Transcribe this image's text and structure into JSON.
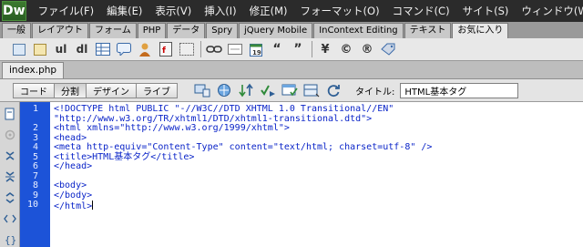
{
  "app": {
    "logo": "Dw"
  },
  "menu": [
    "ファイル(F)",
    "編集(E)",
    "表示(V)",
    "挿入(I)",
    "修正(M)",
    "フォーマット(O)",
    "コマンド(C)",
    "サイト(S)",
    "ウィンドウ(W)"
  ],
  "insert_tabs": [
    "一般",
    "レイアウト",
    "フォーム",
    "PHP",
    "データ",
    "Spry",
    "jQuery Mobile",
    "InContext Editing",
    "テキスト",
    "お気に入り"
  ],
  "insert_tab_active": "お気に入り",
  "insert_icons": [
    "image-icon",
    "image-icon-2",
    "ul",
    "dl",
    "table-icon",
    "comment-icon",
    "user-icon",
    "flash-icon",
    "div-icon",
    "link-icon",
    "spacer-icon",
    "date-icon",
    "“",
    "”",
    "¥",
    "©",
    "®",
    "tag-icon"
  ],
  "document": {
    "tab": "index.php"
  },
  "doc_toolbar": {
    "views": [
      "コード",
      "分割",
      "デザイン",
      "ライブ"
    ],
    "active_view": "分割",
    "title_label": "タイトル:",
    "title_value": "HTML基本タグ"
  },
  "editor": {
    "line_numbers": [
      "1",
      "2",
      "3",
      "4",
      "5",
      "6",
      "7",
      "8",
      "9",
      "10"
    ],
    "lines": [
      "<!DOCTYPE html PUBLIC \"-//W3C//DTD XHTML 1.0 Transitional//EN\"",
      "\"http://www.w3.org/TR/xhtml1/DTD/xhtml1-transitional.dtd\">",
      "<html xmlns=\"http://www.w3.org/1999/xhtml\">",
      "<head>",
      "<meta http-equiv=\"Content-Type\" content=\"text/html; charset=utf-8\" />",
      "<title>HTML基本タグ</title>",
      "</head>",
      "",
      "<body>",
      "</body>",
      "</html>"
    ]
  },
  "colors": {
    "gutter": "#1c53d8",
    "code_text": "#0a24c8",
    "menubar": "#2b2b2b"
  }
}
